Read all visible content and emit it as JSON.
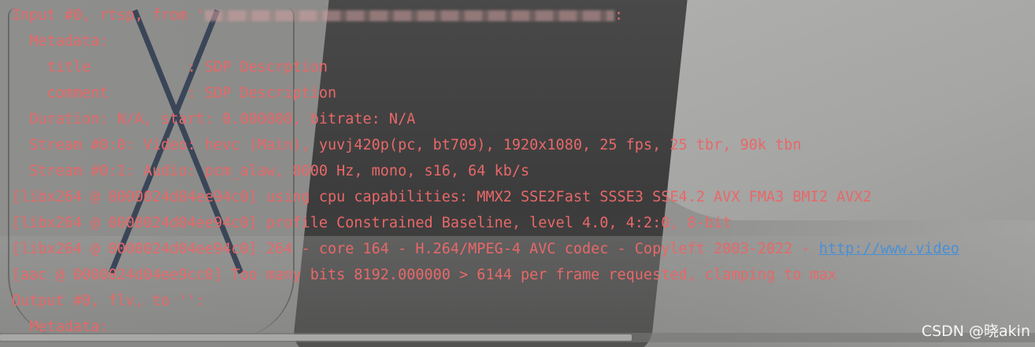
{
  "console": {
    "text_color": "#e86868",
    "link_color": "#4a8fd6",
    "lines": {
      "l0_prefix": "Input #0, rtsp, from '",
      "l0_suffix": ":",
      "l1": "  Metadata:",
      "l2": "    title           : SDP Descrption",
      "l3": "    comment         : SDP Description",
      "l4": "  Duration: N/A, start: 0.000000, bitrate: N/A",
      "l5": "  Stream #0:0: Video: hevc (Main), yuvj420p(pc, bt709), 1920x1080, 25 fps, 25 tbr, 90k tbn",
      "l6": "  Stream #0:1: Audio: pcm_alaw, 8000 Hz, mono, s16, 64 kb/s",
      "l7": "[libx264 @ 0000024d04ee94c0] using cpu capabilities: MMX2 SSE2Fast SSSE3 SSE4.2 AVX FMA3 BMI2 AVX2",
      "l8": "[libx264 @ 0000024d04ee94c0] profile Constrained Baseline, level 4.0, 4:2:0, 8-bit",
      "l9_text": "[libx264 @ 0000024d04ee94c0] 264 - core 164 - H.264/MPEG-4 AVC codec - Copyleft 2003-2022 - ",
      "l9_link": "http://www.video",
      "l10": "[aac @ 0000024d04ee9cc0] Too many bits 8192.000000 > 6144 per frame requested, clamping to max",
      "l11": "Output #0, flv, to '':",
      "l12": "  Metadata:"
    }
  },
  "watermark": {
    "text": "CSDN @晓akin"
  }
}
